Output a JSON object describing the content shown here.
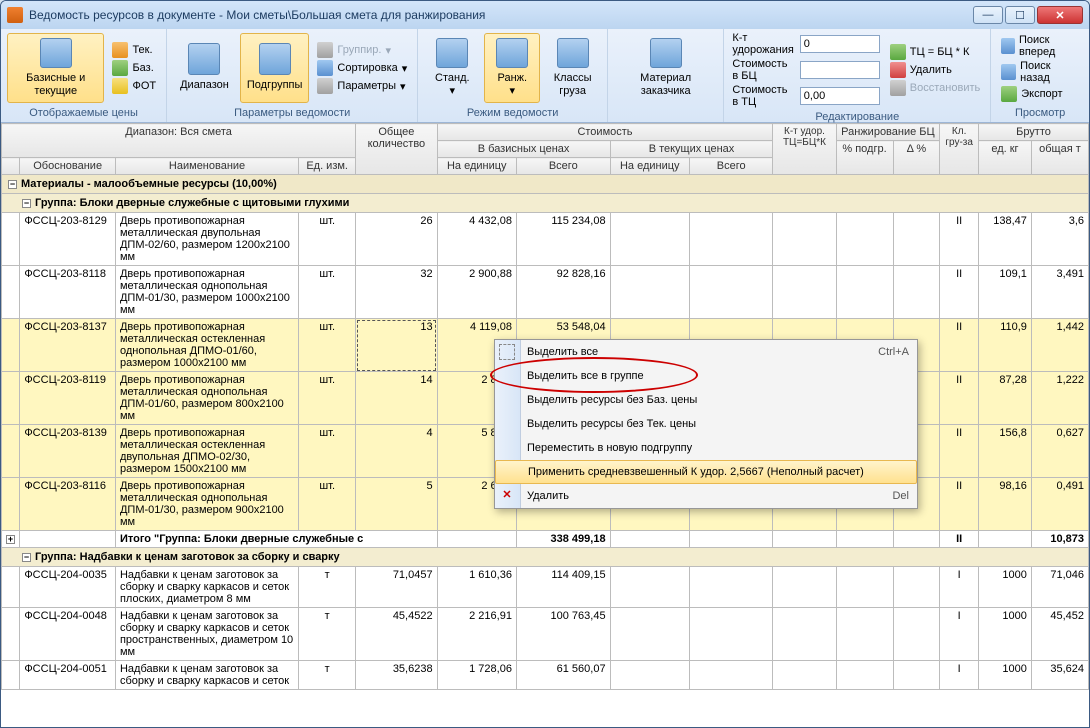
{
  "title": "Ведомость ресурсов в документе - Мои сметы\\Большая смета для ранжирования",
  "ribbon": {
    "g1": {
      "label": "Отображаемые цены",
      "big": "Базисные и текущие",
      "tek": "Тек.",
      "baz": "Баз.",
      "fot": "ФОТ"
    },
    "g2": {
      "label": "Параметры ведомости",
      "diap": "Диапазон",
      "podg": "Подгруппы",
      "grp": "Группир.",
      "sort": "Сортировка",
      "param": "Параметры"
    },
    "g3": {
      "label": "Режим ведомости",
      "std": "Станд.",
      "rang": "Ранж.",
      "klass": "Классы груза"
    },
    "g4": {
      "label": "",
      "mat": "Материал заказчика"
    },
    "g5": {
      "label": "Редактирование",
      "k1": "К-т удорожания",
      "k2": "Стоимость в БЦ",
      "k3": "Стоимость в ТЦ",
      "v1": "0",
      "v3": "0,00",
      "tc": "ТЦ = БЦ * К",
      "del": "Удалить",
      "rec": "Восстановить"
    },
    "g6": {
      "label": "Просмотр",
      "pf": "Поиск вперед",
      "pb": "Поиск назад",
      "ex": "Экспорт"
    }
  },
  "headers": {
    "diap": "Диапазон: Вся смета",
    "obsh": "Общее количество",
    "stoim": "Стоимость",
    "baz": "В базисных ценах",
    "tek": "В текущих ценах",
    "obosn": "Обоснование",
    "naim": "Наименование",
    "ed": "Ед. изм.",
    "naed": "На единицу",
    "vsego": "Всего",
    "kudor": "К-т удор. ТЦ=БЦ*К",
    "rang": "Ранжирование БЦ",
    "podg": "% подгр.",
    "delta": "Δ %",
    "klg": "Кл. гру-за",
    "brutto": "Брутто",
    "edkg": "ед. кг",
    "obt": "общая т"
  },
  "sections": {
    "mat": "Материалы - малообъемные ресурсы (10,00%)",
    "grp1": "Группа: Блоки дверные служебные с щитовыми глухими",
    "itog1": "Итого \"Группа: Блоки дверные служебные с",
    "itog1v": "338 499,18",
    "itog1t": "10,873",
    "grp2": "Группа: Надбавки к ценам заготовок за сборку и сварку"
  },
  "rows": [
    {
      "c": "ФССЦ-203-8129",
      "n": "Дверь противопожарная металлическая двупольная ДПМ-02/60, размером 1200x2100 мм",
      "e": "шт.",
      "q": "26",
      "u": "4 432,08",
      "v": "115 234,08",
      "kl": "II",
      "kg": "138,47",
      "t": "3,6"
    },
    {
      "c": "ФССЦ-203-8118",
      "n": "Дверь противопожарная металлическая однопольная ДПМ-01/30, размером 1000x2100 мм",
      "e": "шт.",
      "q": "32",
      "u": "2 900,88",
      "v": "92 828,16",
      "kl": "II",
      "kg": "109,1",
      "t": "3,491"
    },
    {
      "c": "ФССЦ-203-8137",
      "n": "Дверь противопожарная металлическая остекленная однопольная ДПМО-01/60, размером 1000x2100 мм",
      "e": "шт.",
      "q": "13",
      "u": "4 119,08",
      "v": "53 548,04",
      "kl": "II",
      "kg": "110,9",
      "t": "1,442",
      "sel": true,
      "dash": true
    },
    {
      "c": "ФССЦ-203-8119",
      "n": "Дверь противопожарная металлическая однопольная ДПМ-01/60, размером 800x2100 мм",
      "e": "шт.",
      "q": "14",
      "u": "2 884,",
      "v": "",
      "kl": "II",
      "kg": "87,28",
      "t": "1,222",
      "sel": true
    },
    {
      "c": "ФССЦ-203-8139",
      "n": "Дверь противопожарная металлическая остекленная двупольная ДПМО-02/30, размером 1500x2100 мм",
      "e": "шт.",
      "q": "4",
      "u": "5 825,",
      "v": "",
      "kl": "II",
      "kg": "156,8",
      "t": "0,627",
      "sel": true
    },
    {
      "c": "ФССЦ-203-8116",
      "n": "Дверь противопожарная металлическая однопольная ДПМ-01/30, размером 900x2100 мм",
      "e": "шт.",
      "q": "5",
      "u": "2 640,",
      "v": "",
      "kl": "II",
      "kg": "98,16",
      "t": "0,491",
      "sel": true
    }
  ],
  "rows2": [
    {
      "c": "ФССЦ-204-0035",
      "n": "Надбавки к ценам заготовок за сборку и сварку каркасов и сеток плоских, диаметром 8 мм",
      "e": "т",
      "q": "71,0457",
      "u": "1 610,36",
      "v": "114 409,15",
      "kl": "I",
      "kg": "1000",
      "t": "71,046"
    },
    {
      "c": "ФССЦ-204-0048",
      "n": "Надбавки к ценам заготовок за сборку и сварку каркасов и сеток пространственных, диаметром 10 мм",
      "e": "т",
      "q": "45,4522",
      "u": "2 216,91",
      "v": "100 763,45",
      "kl": "I",
      "kg": "1000",
      "t": "45,452"
    },
    {
      "c": "ФССЦ-204-0051",
      "n": "Надбавки к ценам заготовок за сборку и сварку каркасов и сеток",
      "e": "т",
      "q": "35,6238",
      "u": "1 728,06",
      "v": "61 560,07",
      "kl": "I",
      "kg": "1000",
      "t": "35,624"
    }
  ],
  "ctx": {
    "i1": "Выделить все",
    "i1s": "Ctrl+A",
    "i2": "Выделить все в группе",
    "i3": "Выделить ресурсы без Баз. цены",
    "i4": "Выделить ресурсы без Тек. цены",
    "i5": "Переместить в новую подгруппу",
    "i6": "Применить средневзвешенный К удор. 2,5667 (Неполный расчет)",
    "i7": "Удалить",
    "i7s": "Del"
  }
}
